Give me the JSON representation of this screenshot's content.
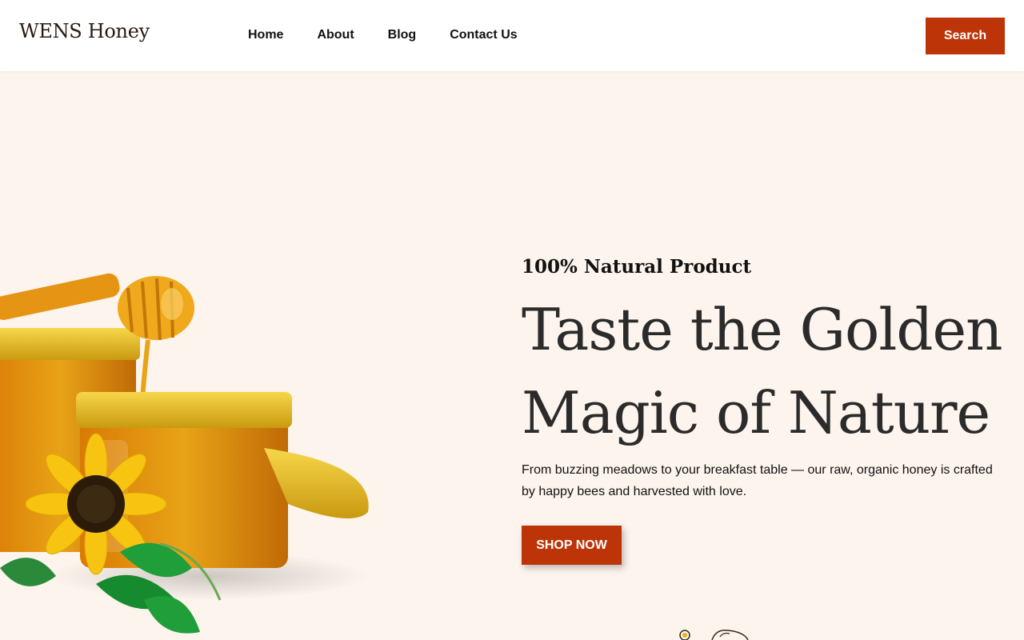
{
  "header": {
    "logo": "WENS Honey",
    "nav": [
      "Home",
      "About",
      "Blog",
      "Contact Us"
    ],
    "search_label": "Search"
  },
  "hero": {
    "eyebrow": "100% Natural Product",
    "title_line1": "Taste the Golden",
    "title_line2": "Magic of Nature",
    "description": "From buzzing meadows to your breakfast table — our raw, organic honey is crafted by happy bees and harvested with love.",
    "cta_label": "SHOP NOW"
  },
  "colors": {
    "accent": "#bc3408",
    "background": "#fcf4ed",
    "honey": "#e8a317"
  },
  "icons": [
    "honey-jar-image",
    "sunflower-icon",
    "honey-dipper-icon",
    "bee-icon"
  ]
}
